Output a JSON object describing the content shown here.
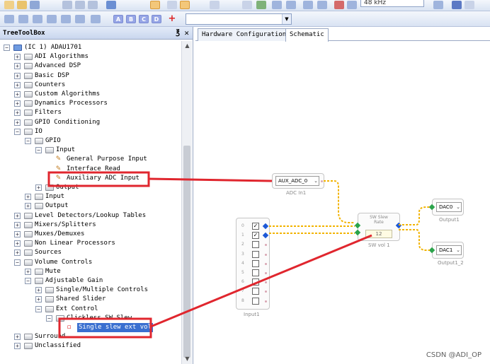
{
  "toolbar": {
    "sample_rate": "48 kHz",
    "block_buttons": [
      "A",
      "B",
      "C",
      "D"
    ],
    "add_symbol": "+"
  },
  "left_panel": {
    "title": "TreeToolBox",
    "pin_glyph": "℥",
    "close_glyph": "✕",
    "tree": [
      {
        "label": "(IC 1) ADAU1701",
        "exp": "−"
      },
      {
        "label": "ADI Algorithms",
        "exp": "+"
      },
      {
        "label": "Advanced DSP",
        "exp": "+"
      },
      {
        "label": "Basic DSP",
        "exp": "+"
      },
      {
        "label": "Counters",
        "exp": "+"
      },
      {
        "label": "Custom Algorithms",
        "exp": "+"
      },
      {
        "label": "Dynamics Processors",
        "exp": "+"
      },
      {
        "label": "Filters",
        "exp": "+"
      },
      {
        "label": "GPIO Conditioning",
        "exp": "+"
      },
      {
        "label": "IO",
        "exp": "−"
      },
      {
        "label": "GPIO",
        "exp": "−"
      },
      {
        "label": "Input",
        "exp": "−"
      },
      {
        "label": "General Purpose Input"
      },
      {
        "label": "Interface Read"
      },
      {
        "label": "Auxiliary ADC Input"
      },
      {
        "label": "Output",
        "exp": "+"
      },
      {
        "label": "Input",
        "exp": "+"
      },
      {
        "label": "Output",
        "exp": "+"
      },
      {
        "label": "Level Detectors/Lookup Tables",
        "exp": "+"
      },
      {
        "label": "Mixers/Splitters",
        "exp": "+"
      },
      {
        "label": "Muxes/Demuxes",
        "exp": "+"
      },
      {
        "label": "Non Linear Processors",
        "exp": "+"
      },
      {
        "label": "Sources",
        "exp": "+"
      },
      {
        "label": "Volume Controls",
        "exp": "−"
      },
      {
        "label": "Mute",
        "exp": "+"
      },
      {
        "label": "Adjustable Gain",
        "exp": "−"
      },
      {
        "label": "Single/Multiple Controls",
        "exp": "+"
      },
      {
        "label": "Shared Slider",
        "exp": "+"
      },
      {
        "label": "Ext Control",
        "exp": "−"
      },
      {
        "label": "Clickless SW Slew",
        "exp": "−"
      },
      {
        "label": "Single slew ext vol"
      },
      {
        "label": "Surround",
        "exp": "+"
      },
      {
        "label": "Unclassified",
        "exp": "+"
      }
    ]
  },
  "tabs": [
    {
      "label": "Hardware Configuration",
      "active": false
    },
    {
      "label": "Schematic",
      "active": true
    }
  ],
  "schematic": {
    "adc_block": {
      "dropdown": "AUX_ADC_0",
      "caption": "ADC In1"
    },
    "input_block": {
      "rows": [
        "0",
        "1",
        "2",
        "3",
        "4",
        "5",
        "6",
        "7",
        "8"
      ],
      "checked": [
        true,
        true,
        false,
        false,
        false,
        false,
        false,
        false,
        false
      ],
      "caption": "Input1"
    },
    "slew_block": {
      "title_line1": "SW Slew",
      "title_line2": "Rate",
      "value": "12",
      "caption": "SW vol 1"
    },
    "dac0_block": {
      "dropdown": "DAC0",
      "caption": "Output1"
    },
    "dac1_block": {
      "dropdown": "DAC1",
      "caption": "Output1_2"
    }
  },
  "watermark": "CSDN @ADI_OP",
  "colors": {
    "highlight_box": "#e0262e",
    "wire": "#f2b300",
    "selection": "#3a6fd0"
  }
}
